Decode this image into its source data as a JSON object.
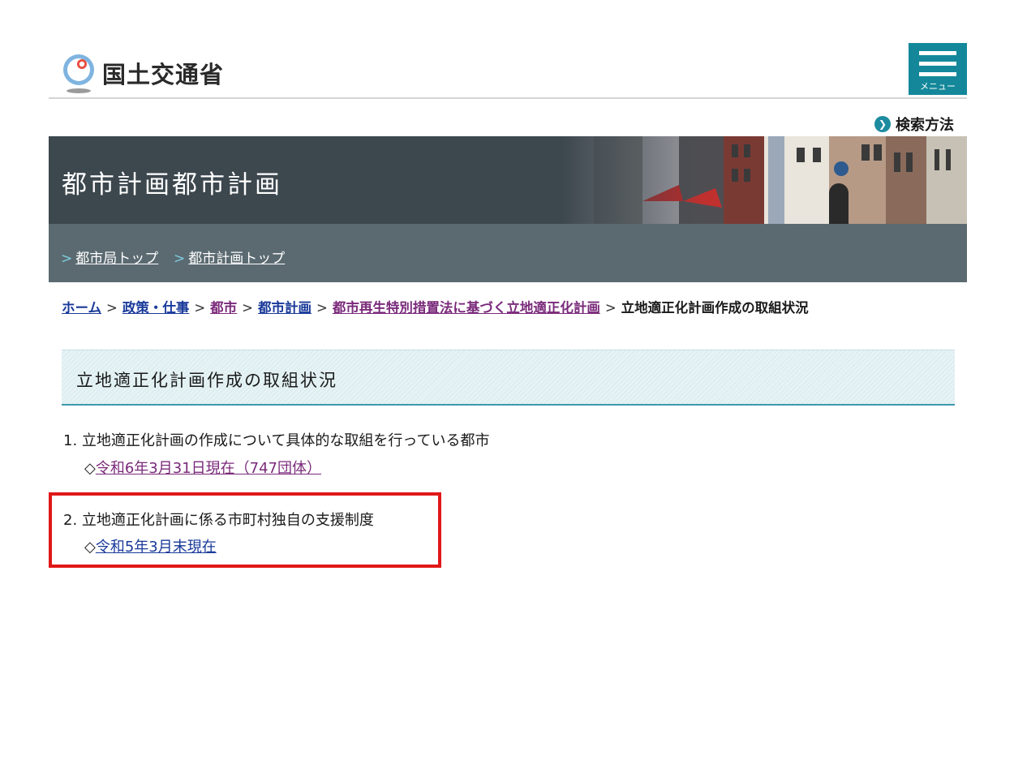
{
  "header": {
    "logo_text": "国土交通省",
    "menu_label": "メニュー"
  },
  "search": {
    "label": "検索方法"
  },
  "banner": {
    "title": "都市計画都市計画"
  },
  "subnav": {
    "items": [
      {
        "label": "都市局トップ"
      },
      {
        "label": "都市計画トップ"
      }
    ]
  },
  "breadcrumb": {
    "items": [
      {
        "label": "ホーム"
      },
      {
        "label": "政策・仕事"
      },
      {
        "label": "都市"
      },
      {
        "label": "都市計画"
      },
      {
        "label": "都市再生特別措置法に基づく立地適正化計画"
      }
    ],
    "separator": ">",
    "current": "立地適正化計画作成の取組状況"
  },
  "page": {
    "heading": "立地適正化計画作成の取組状況",
    "items": [
      {
        "number": "1.",
        "text": "立地適正化計画の作成について具体的な取組を行っている都市",
        "marker": "◇",
        "link": "令和6年3月31日現在（747団体）"
      },
      {
        "number": "2.",
        "text": "立地適正化計画に係る市町村独自の支援制度",
        "marker": "◇",
        "link": "令和5年3月末現在"
      }
    ]
  },
  "colors": {
    "menu_bg": "#14889a",
    "banner_bg": "#3c474e",
    "subnav_bg": "#5b6a71",
    "link": "#1a3a9a",
    "visited": "#7a2a7a",
    "highlight": "#e01818"
  }
}
